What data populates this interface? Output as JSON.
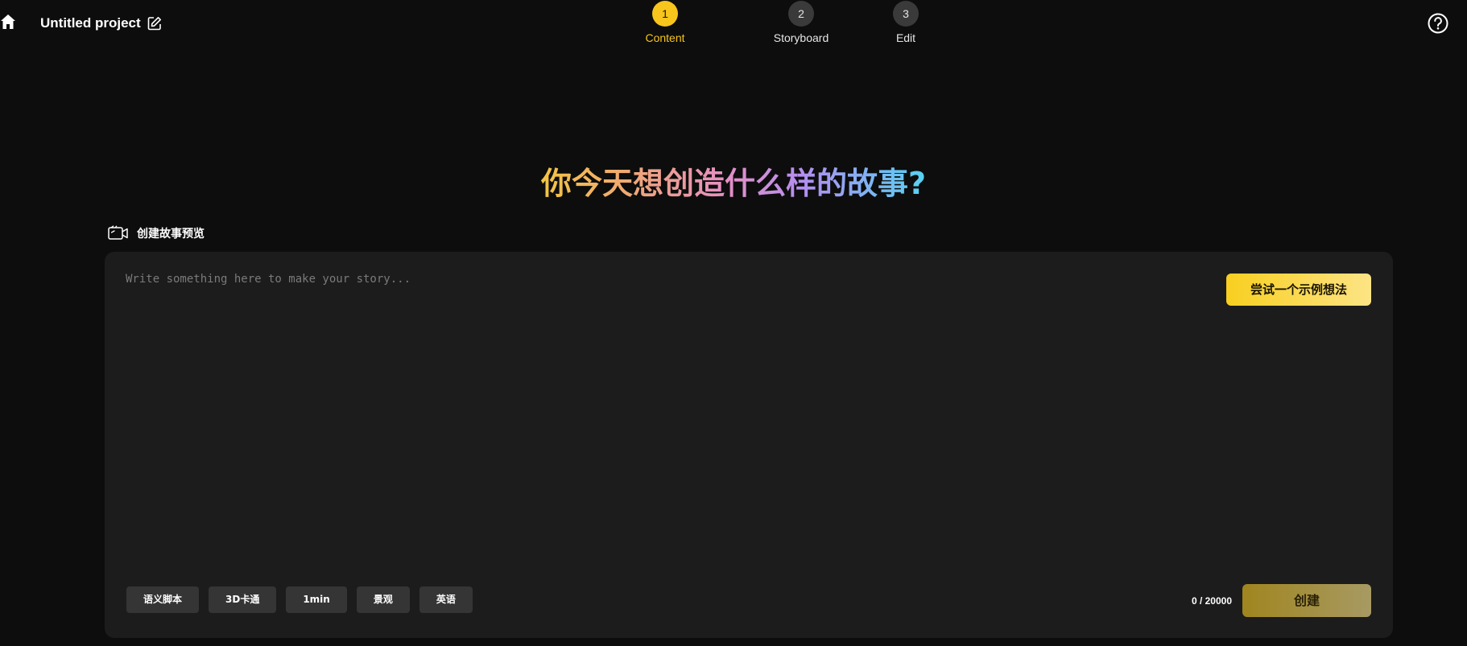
{
  "header": {
    "project_title": "Untitled project",
    "home_icon": "home-icon",
    "edit_icon": "edit-icon",
    "help_icon": "help-icon"
  },
  "steps": [
    {
      "number": "1",
      "label": "Content",
      "active": true
    },
    {
      "number": "2",
      "label": "Storyboard",
      "active": false
    },
    {
      "number": "3",
      "label": "Edit",
      "active": false
    }
  ],
  "headline": "你今天想创造什么样的故事?",
  "section": {
    "label": "创建故事预览",
    "icon": "video-camera-icon"
  },
  "editor": {
    "value": "",
    "placeholder": "Write something here to make your story...",
    "try_example_label": "尝试一个示例想法",
    "char_count": "0 / 20000",
    "create_label": "创建"
  },
  "tags": [
    "语义脚本",
    "3D卡通",
    "1min",
    "景观",
    "英语"
  ],
  "colors": {
    "accent": "#f7c51c",
    "background": "#0d0d0d",
    "panel": "#1c1c1c",
    "tag_bg": "#353535"
  }
}
